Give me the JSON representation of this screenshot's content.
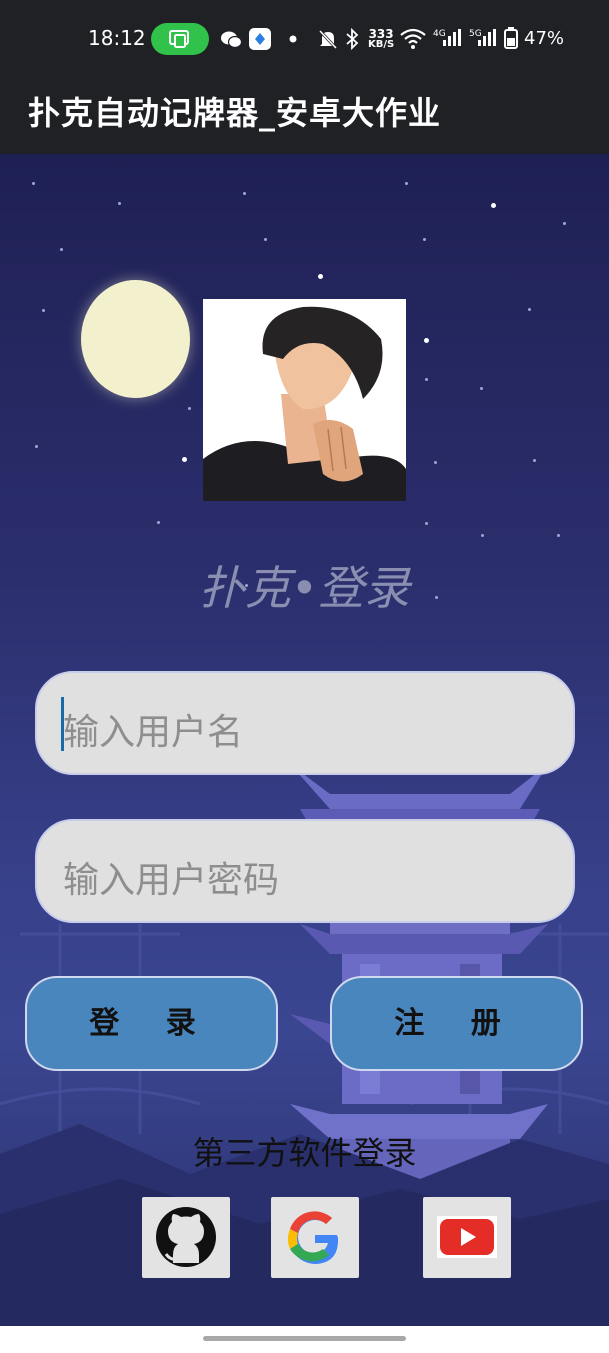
{
  "status_bar": {
    "time": "18:12",
    "speed_value": "333",
    "speed_unit": "KB/S",
    "net_label_1": "4G",
    "net_label_2": "5G",
    "battery": "47%",
    "icons": [
      "screen-cast-icon",
      "wechat-icon",
      "app-notification-icon",
      "dot-icon",
      "mute-icon",
      "bluetooth-icon",
      "wifi-icon",
      "signal-icon",
      "battery-icon"
    ]
  },
  "app_bar": {
    "title": "扑克自动记牌器_安卓大作业"
  },
  "login": {
    "title": "扑克•登录",
    "username_placeholder": "输入用户名",
    "password_placeholder": "输入用户密码",
    "login_button": "登 录",
    "register_button": "注 册"
  },
  "third_party": {
    "label": "第三方软件登录",
    "providers": [
      "github-icon",
      "google-icon",
      "youtube-icon"
    ]
  },
  "colors": {
    "bar_bg": "#1f2124",
    "cast_pill": "#30c24b",
    "button_bg": "#4a86be",
    "input_bg": "#e0e0e0",
    "moon": "#f3f1cd"
  }
}
